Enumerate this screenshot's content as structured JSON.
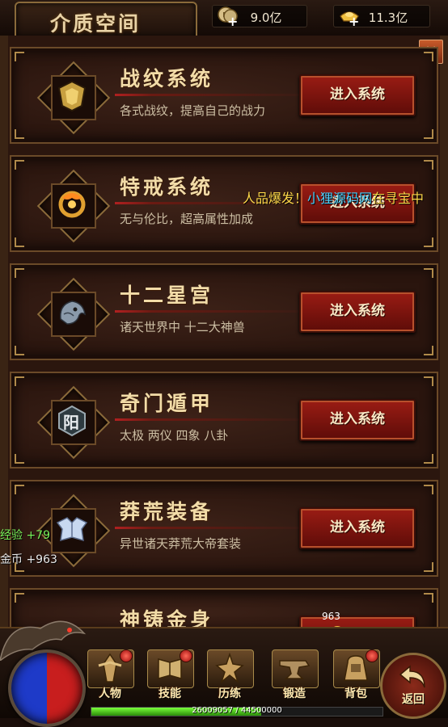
{
  "header": {
    "title": "介质空间",
    "resources": [
      {
        "icon": "coin-icon",
        "value": "9.0亿"
      },
      {
        "icon": "gold-ingot-icon",
        "value": "11.3亿"
      }
    ]
  },
  "close_label": "×",
  "systems": [
    {
      "name": "战纹系统",
      "desc": "各式战纹，提高自己的战力",
      "button": "进入系统",
      "icon": "shield-emblem-icon"
    },
    {
      "name": "特戒系统",
      "desc": "无与伦比，超高属性加成",
      "button": "进入系统",
      "icon": "dragon-ring-icon"
    },
    {
      "name": "十二星宫",
      "desc": "诸天世界中 十二大神兽",
      "button": "进入系统",
      "icon": "beast-head-icon"
    },
    {
      "name": "奇门遁甲",
      "desc": "太极 两仪 四象 八卦",
      "button": "进入系统",
      "icon": "yang-seal-icon"
    },
    {
      "name": "莽荒装备",
      "desc": "异世诸天莽荒大帝套装",
      "button": "进入系统",
      "icon": "armor-icon"
    },
    {
      "name": "神铸金身",
      "desc": "",
      "button": "",
      "icon": "golden-body-icon"
    }
  ],
  "seal_char": "阳",
  "float_message": {
    "prefix": "人品爆发！",
    "link": "小狸源码网",
    "suffix": "在寻宝中"
  },
  "exp_gain": "经验 +79",
  "gold_gain": "金币  +963",
  "gold_drop": "963",
  "nav": [
    {
      "label": "人物",
      "icon": "character-icon",
      "badge": true
    },
    {
      "label": "技能",
      "icon": "skill-book-icon",
      "badge": true
    },
    {
      "label": "历练",
      "icon": "training-icon",
      "badge": false
    },
    {
      "label": "锻造",
      "icon": "anvil-icon",
      "badge": false
    },
    {
      "label": "背包",
      "icon": "bag-icon",
      "badge": true
    }
  ],
  "back_label": "返回",
  "exp": {
    "current": 26009057,
    "max": 44500000,
    "text": "26009057 / 44500000",
    "fraction": 0.5845
  },
  "colors": {
    "accent_red": "#9a1c14",
    "gold_text": "#f2dca8",
    "exp_green": "#7af05a"
  }
}
